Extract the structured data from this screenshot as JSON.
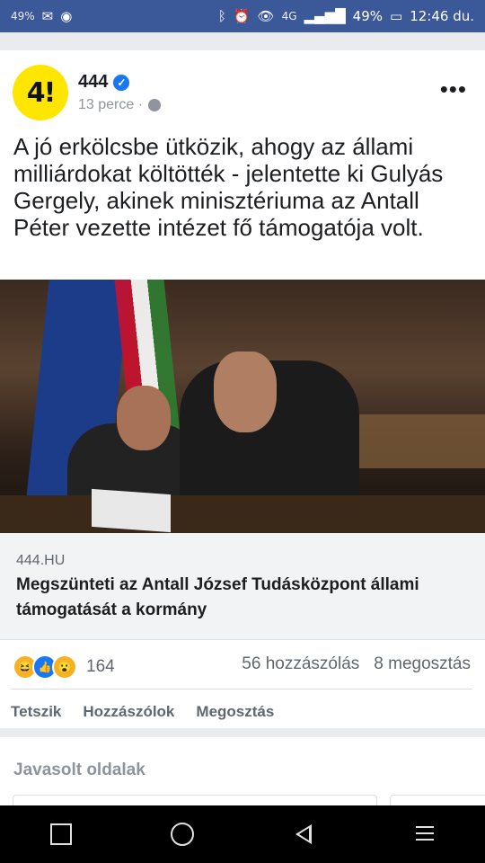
{
  "status_bar": {
    "left_battery": "49%",
    "right_battery": "49%",
    "time": "12:46 du.",
    "network": "4G"
  },
  "post": {
    "page_name": "444",
    "avatar_text": "4!",
    "time_ago": "13 perce ·",
    "text": "A jó erkölcsbe ütközik, ahogy az állami milliárdokat költötték - jelentette ki Gulyás Gergely, akinek minisztériuma az Antall Péter vezette intézet fő támogatója volt.",
    "link": {
      "domain": "444.HU",
      "title": "Megszünteti az Antall József Tudásközpont állami támogatását a kormány"
    },
    "reactions_count": "164",
    "comments": "56 hozzászólás",
    "shares": "8 megosztás",
    "actions": {
      "like": "Tetszik",
      "comment": "Hozzászólok",
      "share": "Megosztás"
    }
  },
  "suggested": {
    "title": "Javasolt oldalak"
  },
  "colors": {
    "facebook_blue": "#3b5998",
    "avatar_yellow": "#ffe600",
    "verified_blue": "#1877f2"
  }
}
